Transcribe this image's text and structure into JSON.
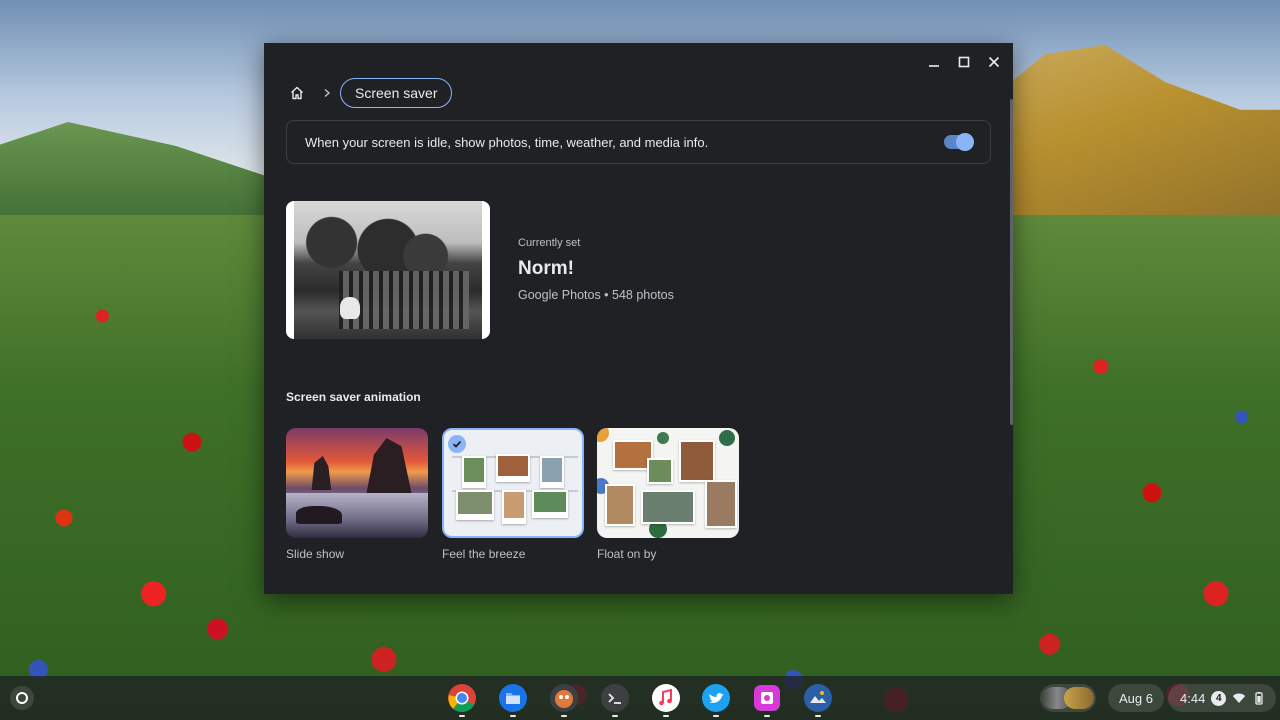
{
  "window": {
    "breadcrumb": {
      "current": "Screen saver"
    },
    "toggle_card": {
      "text": "When your screen is idle, show photos, time, weather, and media info.",
      "enabled": true
    },
    "current_album": {
      "label": "Currently set",
      "title": "Norm!",
      "meta": "Google Photos • 548 photos"
    },
    "animation": {
      "section_title": "Screen saver animation",
      "options": [
        {
          "label": "Slide show",
          "selected": false
        },
        {
          "label": "Feel the breeze",
          "selected": true
        },
        {
          "label": "Float on by",
          "selected": false
        }
      ]
    }
  },
  "shelf": {
    "apps": [
      "chrome-icon",
      "files-icon",
      "chromebook-game-icon",
      "terminal-icon",
      "music-icon",
      "twitter-icon",
      "photo-editor-icon",
      "gallery-icon"
    ],
    "date": "Aug 6",
    "time": "4:44",
    "notification_count": "4"
  },
  "colors": {
    "accent": "#8ab4f8",
    "window_bg": "#202124"
  }
}
